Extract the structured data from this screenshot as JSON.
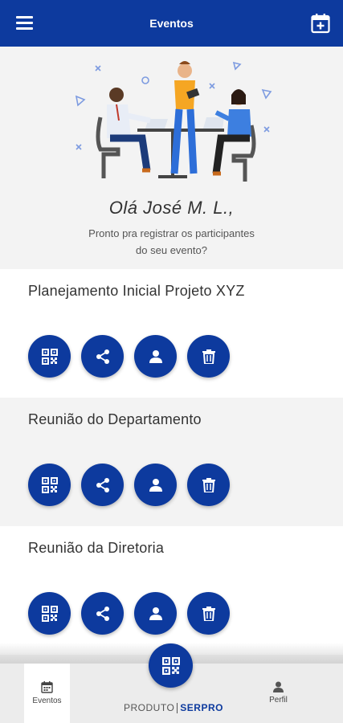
{
  "app_bar": {
    "title": "Eventos",
    "menu_icon": "menu-icon",
    "action_icon": "calendar-add-icon"
  },
  "hero": {
    "greeting": "Olá José M. L.,",
    "subtitle_line1": "Pronto pra registrar os participantes",
    "subtitle_line2": "do seu evento?"
  },
  "events": [
    {
      "name": "Planejamento Inicial Projeto XYZ"
    },
    {
      "name": "Reunião do Departamento"
    },
    {
      "name": "Reunião da Diretoria"
    }
  ],
  "event_actions": [
    "qr-code-icon",
    "share-icon",
    "person-icon",
    "trash-icon"
  ],
  "bottom_nav": {
    "eventos_label": "Eventos",
    "perfil_label": "Perfil",
    "brand_produto": "PRODUTO",
    "brand_serpro": "SERPRO"
  },
  "colors": {
    "primary": "#0d3a9e",
    "background": "#f3f3f3"
  }
}
